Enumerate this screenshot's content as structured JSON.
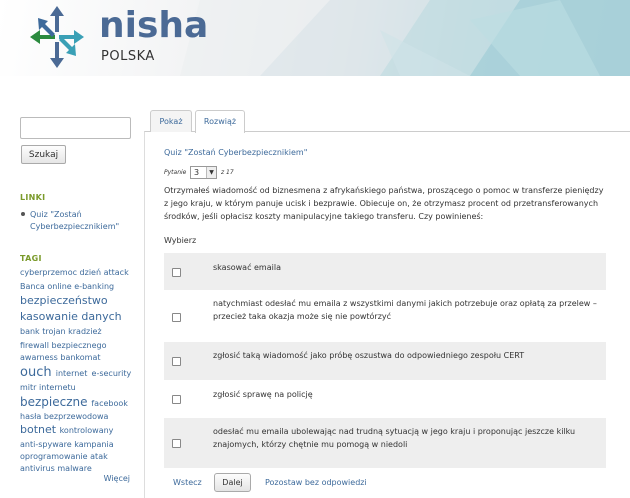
{
  "brand": {
    "name": "nisha",
    "sub": "POLSKA"
  },
  "sidebar": {
    "search_button": "Szukaj",
    "links_title": "LINKI",
    "links": [
      "Quiz \"Zostań Cyberbezpiecznikiem\""
    ],
    "tags_title": "TAGI",
    "tags_lines": [
      [
        "cyberprzemoc",
        "dzień",
        "attack"
      ],
      [
        "Banca",
        "online",
        "e-banking"
      ],
      [
        "bezpieczeństwo"
      ],
      [
        "kasowanie",
        "danych"
      ],
      [
        "bank",
        "trojan",
        "kradzież"
      ],
      [
        "firewall",
        "bezpiecznego"
      ],
      [
        "awarness",
        "bankomat"
      ],
      [
        "ouch",
        "internet",
        "e-security"
      ],
      [
        "mitr",
        "internetu"
      ],
      [
        "bezpieczne",
        "facebook"
      ],
      [
        "hasła",
        "bezprzewodowa"
      ],
      [
        "botnet",
        "kontrolowany"
      ],
      [
        "anti-spyware",
        "kampania"
      ],
      [
        "oprogramowanie",
        "atak"
      ],
      [
        "antivirus",
        "malware"
      ]
    ],
    "more": "Więcej"
  },
  "tabs": [
    {
      "label": "Pokaż",
      "active": false
    },
    {
      "label": "Rozwiąż",
      "active": true
    }
  ],
  "quiz": {
    "title": "Quiz \"Zostań Cyberbezpiecznikiem\"",
    "question_label": "Pytanie",
    "question_number": "3",
    "of_total": "z 17",
    "question": "Otrzymałeś wiadomość od biznesmena z afrykańskiego państwa, proszącego o pomoc w transferze pieniędzy z jego kraju, w którym panuje ucisk i bezprawie. Obiecuje on, że otrzymasz procent od przetransferowanych środków, jeśli opłacisz koszty manipulacyjne takiego transferu. Czy powinieneś:",
    "choose": "Wybierz",
    "answers": [
      "skasować emaila",
      "natychmiast odesłać mu emaila z wszystkimi danymi jakich potrzebuje oraz opłatą za przelew – przecież taka okazja może się nie powtórzyć",
      "zgłosić taką wiadomość jako próbę oszustwa do odpowiedniego zespołu CERT",
      "zgłosić sprawę na policję",
      "odesłać mu emaila ubolewając nad trudną sytuacją w jego kraju i proponując jeszcze kilku znajomych, którzy chętnie mu pomogą w niedoli"
    ],
    "back": "Wstecz",
    "next": "Dalej",
    "skip": "Pozostaw bez odpowiedzi"
  }
}
